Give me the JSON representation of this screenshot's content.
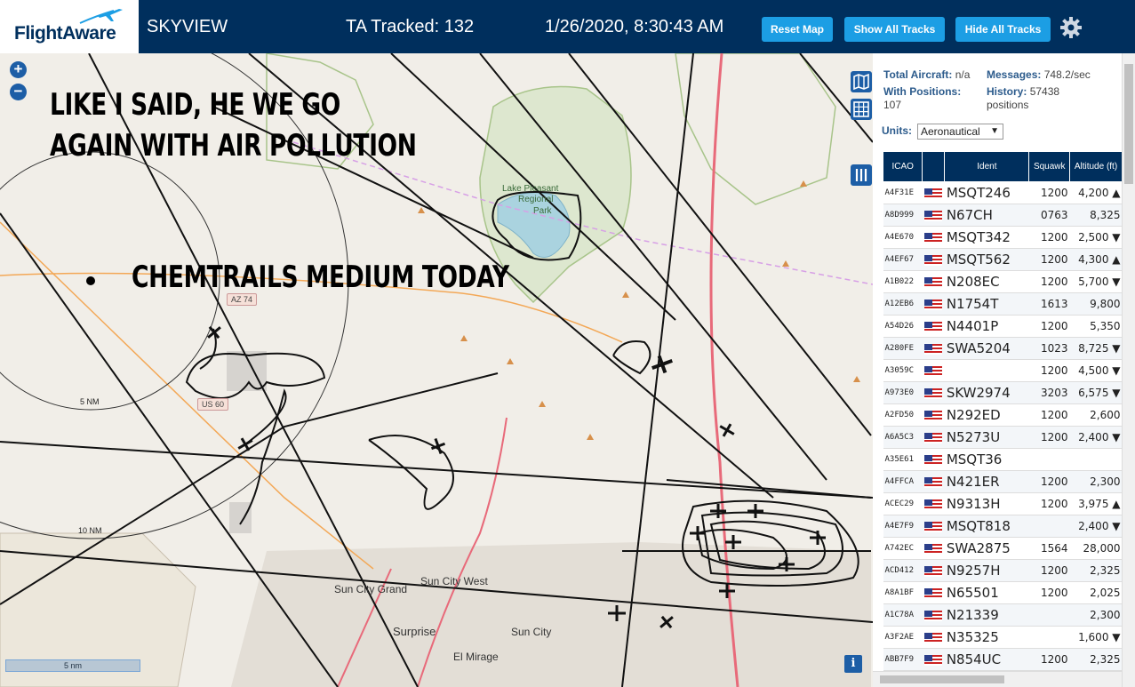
{
  "header": {
    "logo": "FlightAware",
    "app_title": "SKYVIEW",
    "ta_tracked": "TA Tracked: 132",
    "datetime": "1/26/2020, 8:30:43 AM",
    "buttons": {
      "reset_map": "Reset Map",
      "show_all": "Show All Tracks",
      "hide_all": "Hide All Tracks"
    }
  },
  "map": {
    "zoom_in": "+",
    "zoom_out": "−",
    "overlay_text_1": "LIKE I SAID, HE WE GO",
    "overlay_text_2": "AGAIN WITH AIR POLLUTION",
    "overlay_text_3": "CHEMTRAILS MEDIUM TODAY",
    "range_rings": [
      "5 NM",
      "10 NM"
    ],
    "places": [
      "Lake Pleasant",
      "Regional",
      "Park",
      "Sun City Grand",
      "Sun City West",
      "Surprise",
      "Sun City",
      "El Mirage"
    ],
    "roads": [
      "AZ 74",
      "US 60"
    ],
    "scale": "5 nm",
    "info": "i"
  },
  "panel": {
    "total_aircraft_label": "Total Aircraft:",
    "total_aircraft": "n/a",
    "messages_label": "Messages:",
    "messages": "748.2/sec",
    "with_positions_label": "With Positions:",
    "with_positions": "107",
    "history_label": "History:",
    "history": "57438",
    "history_unit": "positions",
    "units_label": "Units:",
    "units_value": "Aeronautical",
    "columns": [
      "ICAO",
      "",
      "Ident",
      "Squawk",
      "Altitude (ft)"
    ],
    "rows": [
      {
        "icao": "A4F31E",
        "ident": "MSQT246",
        "squawk": "1200",
        "alt": "4,200 ▲"
      },
      {
        "icao": "A8D999",
        "ident": "N67CH",
        "squawk": "0763",
        "alt": "8,325"
      },
      {
        "icao": "A4E670",
        "ident": "MSQT342",
        "squawk": "1200",
        "alt": "2,500 ▼"
      },
      {
        "icao": "A4EF67",
        "ident": "MSQT562",
        "squawk": "1200",
        "alt": "4,300 ▲"
      },
      {
        "icao": "A1B022",
        "ident": "N208EC",
        "squawk": "1200",
        "alt": "5,700 ▼"
      },
      {
        "icao": "A12EB6",
        "ident": "N1754T",
        "squawk": "1613",
        "alt": "9,800"
      },
      {
        "icao": "A54D26",
        "ident": "N4401P",
        "squawk": "1200",
        "alt": "5,350"
      },
      {
        "icao": "A280FE",
        "ident": "SWA5204",
        "squawk": "1023",
        "alt": "8,725 ▼"
      },
      {
        "icao": "A3059C",
        "ident": "",
        "squawk": "1200",
        "alt": "4,500 ▼"
      },
      {
        "icao": "A973E0",
        "ident": "SKW2974",
        "squawk": "3203",
        "alt": "6,575 ▼"
      },
      {
        "icao": "A2FD50",
        "ident": "N292ED",
        "squawk": "1200",
        "alt": "2,600"
      },
      {
        "icao": "A6A5C3",
        "ident": "N5273U",
        "squawk": "1200",
        "alt": "2,400 ▼"
      },
      {
        "icao": "A35E61",
        "ident": "MSQT36",
        "squawk": "",
        "alt": ""
      },
      {
        "icao": "A4FFCA",
        "ident": "N421ER",
        "squawk": "1200",
        "alt": "2,300"
      },
      {
        "icao": "ACEC29",
        "ident": "N9313H",
        "squawk": "1200",
        "alt": "3,975 ▲"
      },
      {
        "icao": "A4E7F9",
        "ident": "MSQT818",
        "squawk": "",
        "alt": "2,400 ▼"
      },
      {
        "icao": "A742EC",
        "ident": "SWA2875",
        "squawk": "1564",
        "alt": "28,000"
      },
      {
        "icao": "ACD412",
        "ident": "N9257H",
        "squawk": "1200",
        "alt": "2,325"
      },
      {
        "icao": "A8A1BF",
        "ident": "N65501",
        "squawk": "1200",
        "alt": "2,025"
      },
      {
        "icao": "A1C78A",
        "ident": "N21339",
        "squawk": "",
        "alt": "2,300"
      },
      {
        "icao": "A3F2AE",
        "ident": "N35325",
        "squawk": "",
        "alt": "1,600 ▼"
      },
      {
        "icao": "ABB7F9",
        "ident": "N854UC",
        "squawk": "1200",
        "alt": "2,325"
      }
    ]
  },
  "colors": {
    "header_bg": "#002f5d",
    "button": "#1c9ee4",
    "map_bg": "#f1eee8"
  }
}
